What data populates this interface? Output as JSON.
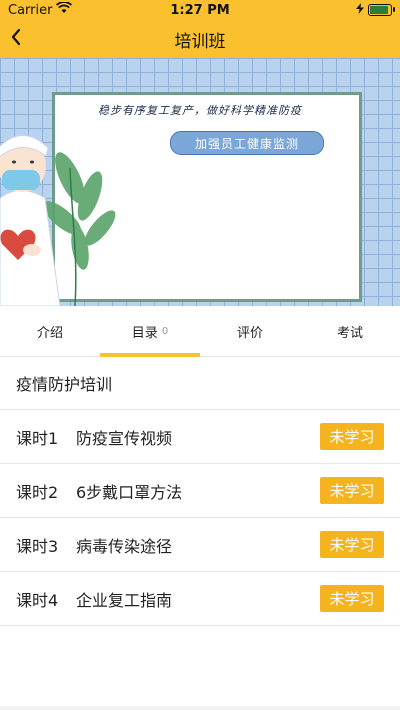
{
  "status_bar": {
    "carrier": "Carrier",
    "time": "1:27 PM",
    "battery_level": 0.9
  },
  "nav": {
    "title": "培训班",
    "back_icon": "chevron-left-icon"
  },
  "banner": {
    "line": "稳步有序复工复产，做好科学精准防疫",
    "pill": "加强员工健康监测"
  },
  "tabs": [
    {
      "label": "介绍",
      "count": ""
    },
    {
      "label": "目录",
      "count": "0"
    },
    {
      "label": "评价",
      "count": ""
    },
    {
      "label": "考试",
      "count": ""
    }
  ],
  "active_tab": 1,
  "course": {
    "title": "疫情防护培训"
  },
  "lessons": [
    {
      "number": "课时1",
      "title": "防疫宣传视频",
      "status": "未学习"
    },
    {
      "number": "课时2",
      "title": "6步戴口罩方法",
      "status": "未学习"
    },
    {
      "number": "课时3",
      "title": "病毒传染途径",
      "status": "未学习"
    },
    {
      "number": "课时4",
      "title": "企业复工指南",
      "status": "未学习"
    }
  ],
  "colors": {
    "accent": "#fbc02d",
    "status_button": "#f5b41e"
  }
}
